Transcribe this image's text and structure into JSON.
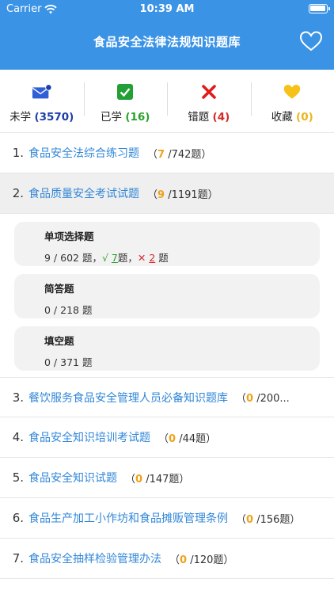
{
  "status": {
    "carrier": "Carrier",
    "time": "10:39 AM"
  },
  "nav": {
    "title": "食品安全法律法规知识题库"
  },
  "stats": [
    {
      "label": "未学",
      "count": "(3570)",
      "icon": "envelope-icon"
    },
    {
      "label": "已学",
      "count": "(16)",
      "icon": "checkbox-icon"
    },
    {
      "label": "错题",
      "count": "(4)",
      "icon": "cross-icon"
    },
    {
      "label": "收藏",
      "count": "(0)",
      "icon": "heart-icon"
    }
  ],
  "items": [
    {
      "num": "1.",
      "title": "食品安全法综合练习题",
      "open": "（",
      "done": "7",
      "total": " /742题）"
    },
    {
      "num": "2.",
      "title": "食品质量安全考试试题",
      "open": "（",
      "done": "9",
      "total": " /1191题）"
    },
    {
      "num": "3.",
      "title": "餐饮服务食品安全管理人员必备知识题库",
      "open": "（",
      "done": "0",
      "total": " /200..."
    },
    {
      "num": "4.",
      "title": "食品安全知识培训考试题",
      "open": "（",
      "done": "0",
      "total": " /44题）"
    },
    {
      "num": "5.",
      "title": "食品安全知识试题",
      "open": "（",
      "done": "0",
      "total": " /147题）"
    },
    {
      "num": "6.",
      "title": "食品生产加工小作坊和食品摊贩管理条例",
      "open": "（",
      "done": "0",
      "total": " /156题）"
    },
    {
      "num": "7.",
      "title": "食品安全抽样检验管理办法",
      "open": "（",
      "done": "0",
      "total": " /120题）"
    }
  ],
  "subsections": [
    {
      "name": "单项选择题",
      "progress": "9 / 602 题，",
      "check": "√",
      "correct": "7",
      "correct_unit": "题，",
      "cross": "✕",
      "wrong": "2",
      "wrong_unit": " 题"
    },
    {
      "name": "简答题",
      "progress": "0 / 218 题"
    },
    {
      "name": "填空题",
      "progress": "0 / 371 题"
    }
  ]
}
